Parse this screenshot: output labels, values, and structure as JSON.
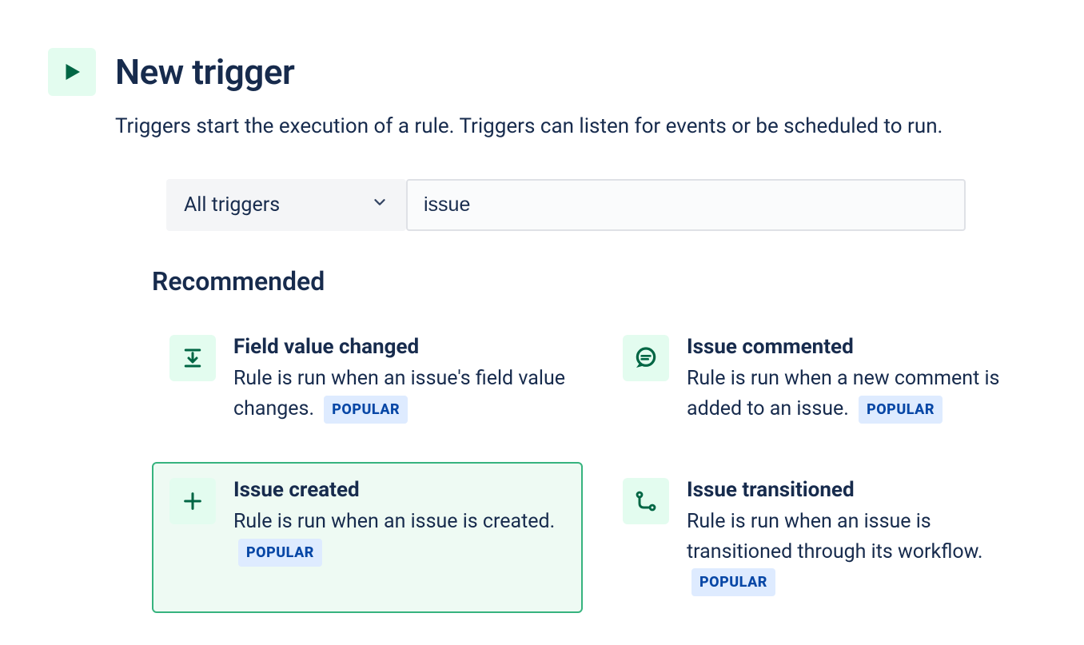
{
  "header": {
    "title": "New trigger",
    "description": "Triggers start the execution of a rule. Triggers can listen for events or be scheduled to run."
  },
  "filter": {
    "dropdown_label": "All triggers",
    "search_value": "issue"
  },
  "section": {
    "title": "Recommended"
  },
  "badges": {
    "popular": "POPULAR"
  },
  "cards": [
    {
      "title": "Field value changed",
      "description": "Rule is run when an issue's field value changes.",
      "popular": true,
      "selected": false,
      "icon": "download-icon"
    },
    {
      "title": "Issue commented",
      "description": "Rule is run when a new comment is added to an issue.",
      "popular": true,
      "selected": false,
      "icon": "comment-icon"
    },
    {
      "title": "Issue created",
      "description": "Rule is run when an issue is created.",
      "popular": true,
      "selected": true,
      "icon": "plus-icon"
    },
    {
      "title": "Issue transitioned",
      "description": "Rule is run when an issue is transitioned through its workflow.",
      "popular": true,
      "selected": false,
      "icon": "transition-icon"
    }
  ]
}
